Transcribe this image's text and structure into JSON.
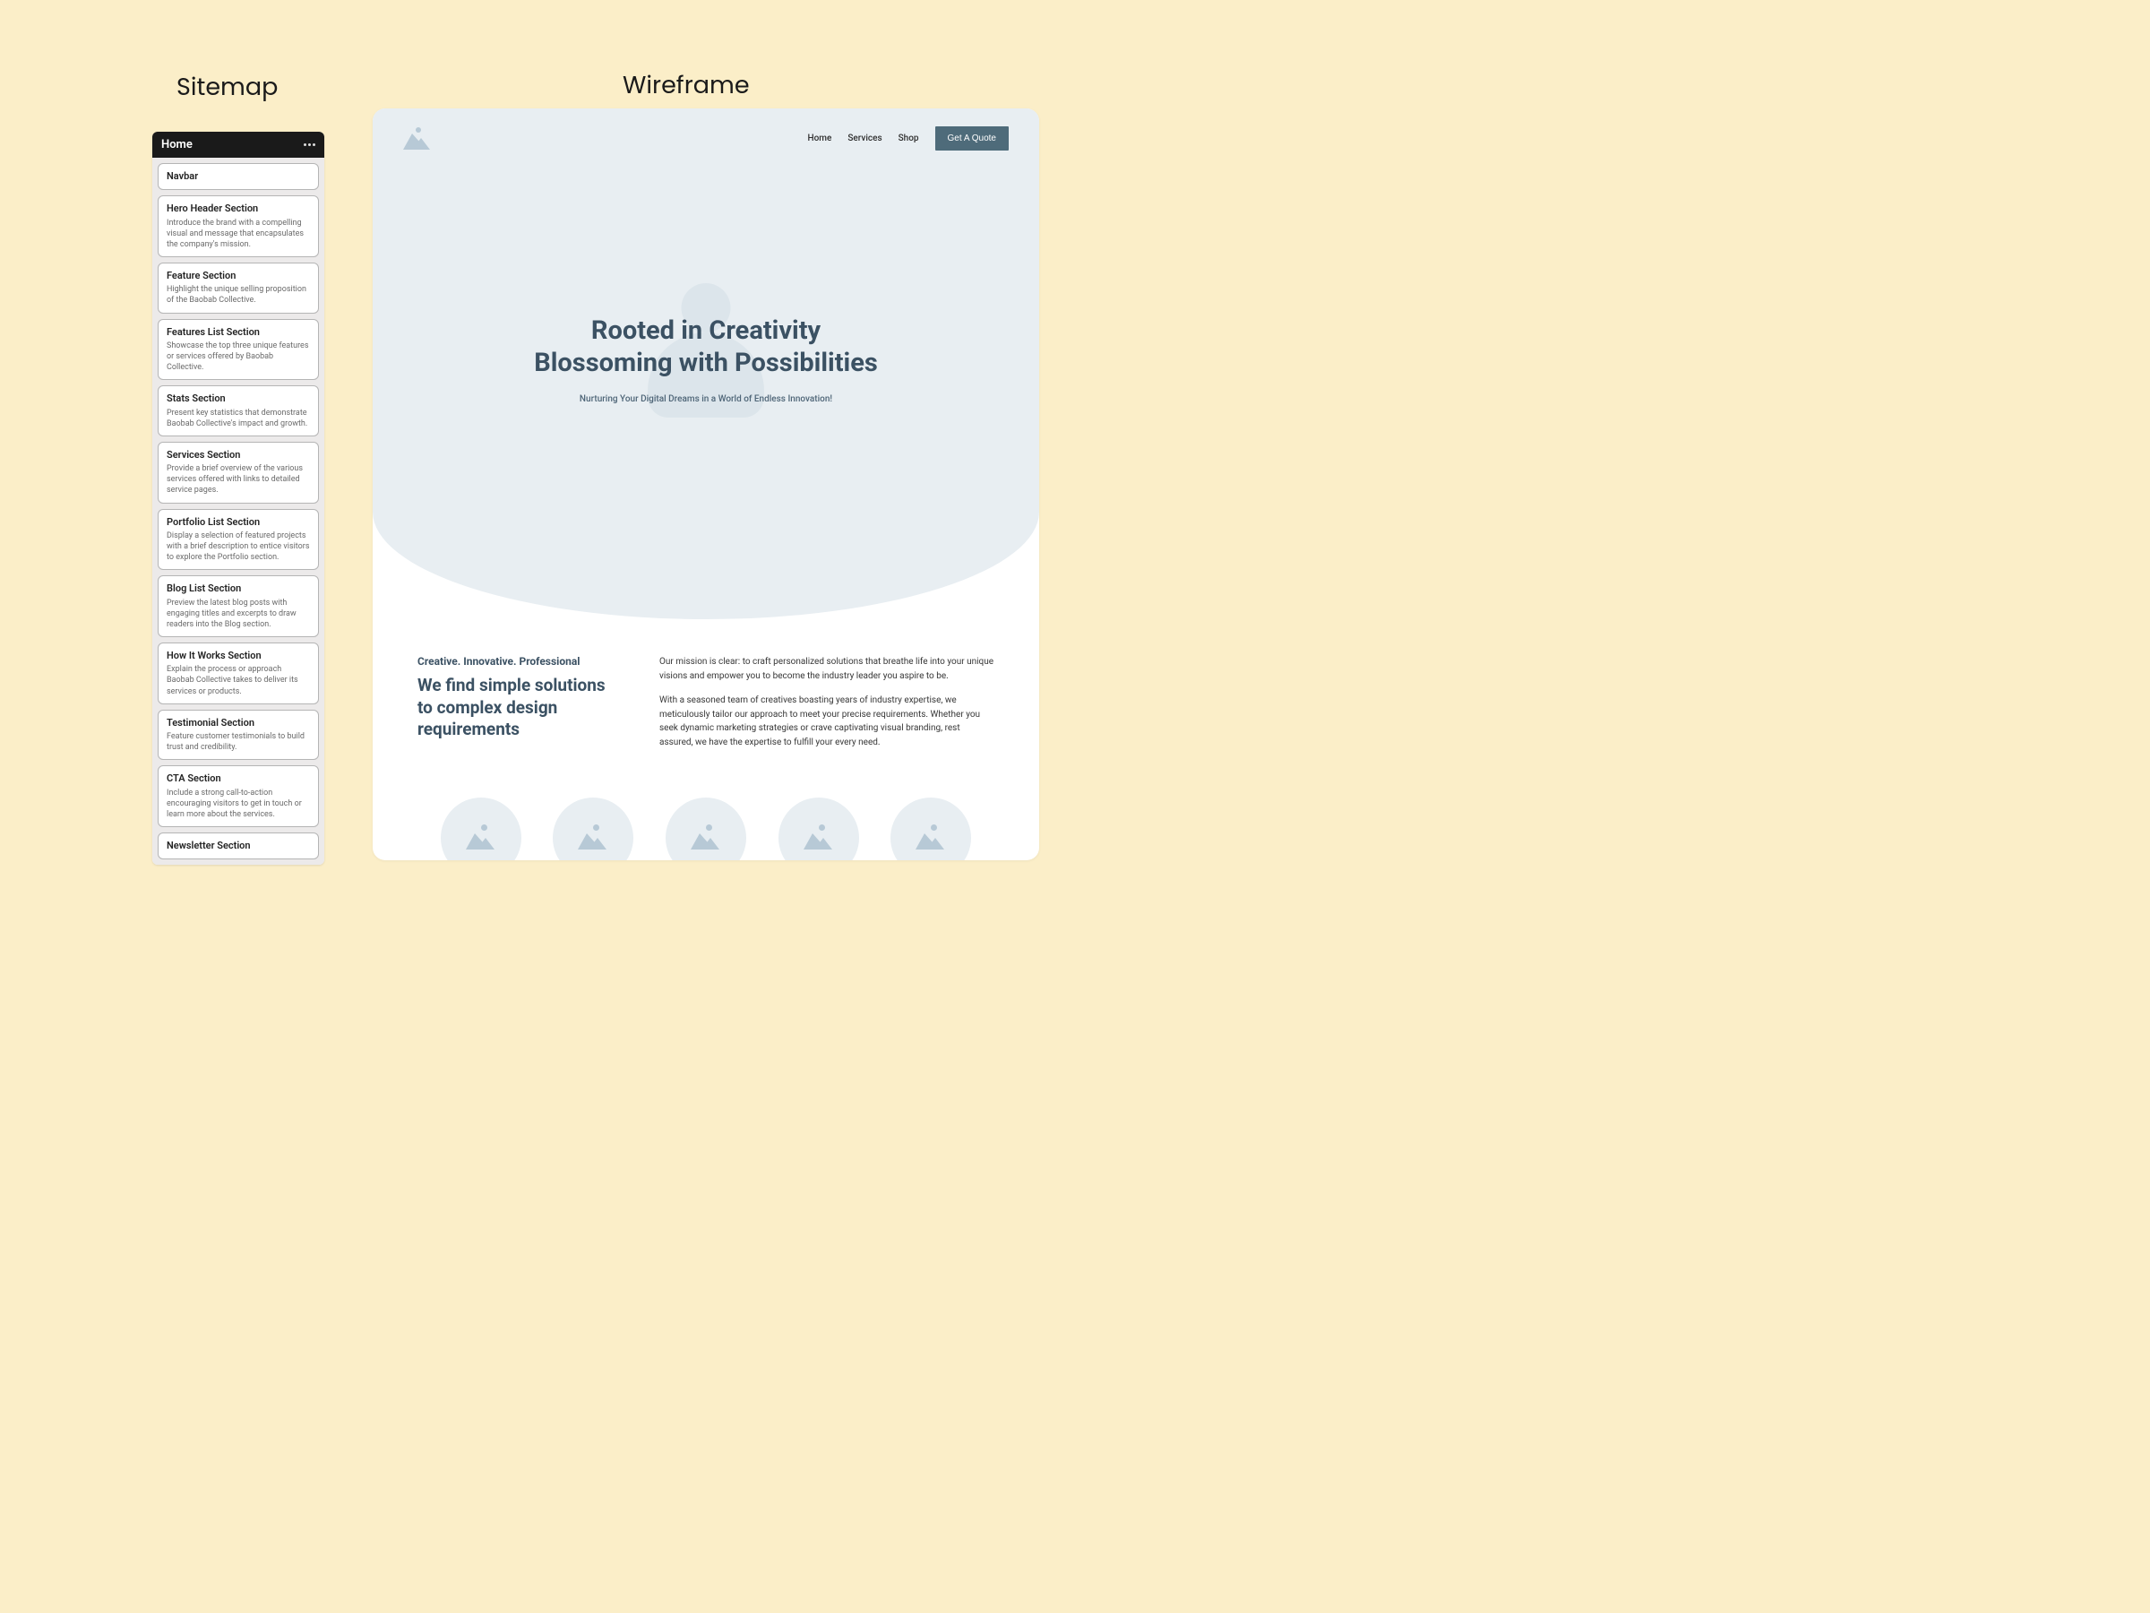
{
  "headings": {
    "sitemap": "Sitemap",
    "wireframe": "Wireframe"
  },
  "sitemap": {
    "page_title": "Home",
    "cards": [
      {
        "title": "Navbar",
        "desc": ""
      },
      {
        "title": "Hero Header Section",
        "desc": "Introduce the brand with a compelling visual and message that encapsulates the company's mission."
      },
      {
        "title": "Feature Section",
        "desc": "Highlight the unique selling proposition of the Baobab Collective."
      },
      {
        "title": "Features List Section",
        "desc": "Showcase the top three unique features or services offered by Baobab Collective."
      },
      {
        "title": "Stats Section",
        "desc": "Present key statistics that demonstrate Baobab Collective's impact and growth."
      },
      {
        "title": "Services Section",
        "desc": "Provide a brief overview of the various services offered with links to detailed service pages."
      },
      {
        "title": "Portfolio List Section",
        "desc": "Display a selection of featured projects with a brief description to entice visitors to explore the Portfolio section."
      },
      {
        "title": "Blog List Section",
        "desc": "Preview the latest blog posts with engaging titles and excerpts to draw readers into the Blog section."
      },
      {
        "title": "How It Works Section",
        "desc": "Explain the process or approach Baobab Collective takes to deliver its services or products."
      },
      {
        "title": "Testimonial Section",
        "desc": "Feature customer testimonials to build trust and credibility."
      },
      {
        "title": "CTA Section",
        "desc": "Include a strong call-to-action encouraging visitors to get in touch or learn more about the services."
      },
      {
        "title": "Newsletter Section",
        "desc": ""
      }
    ]
  },
  "wireframe": {
    "nav": {
      "links": [
        "Home",
        "Services",
        "Shop"
      ],
      "cta": "Get A Quote"
    },
    "hero": {
      "title_line1": "Rooted in Creativity",
      "title_line2": "Blossoming with Possibilities",
      "subtitle": "Nurturing Your Digital Dreams in a World of Endless Innovation!"
    },
    "feature": {
      "eyebrow": "Creative. Innovative. Professional",
      "title": "We find simple solutions to complex design requirements",
      "para1": "Our mission is clear: to craft personalized solutions that breathe life into your unique visions and empower you to become the industry leader you aspire to be.",
      "para2": "With a seasoned team of creatives boasting years of industry expertise, we meticulously tailor our approach to meet your precise requirements. Whether you seek dynamic marketing strategies or crave captivating visual branding, rest assured, we have the expertise to fulfill your every need."
    }
  }
}
